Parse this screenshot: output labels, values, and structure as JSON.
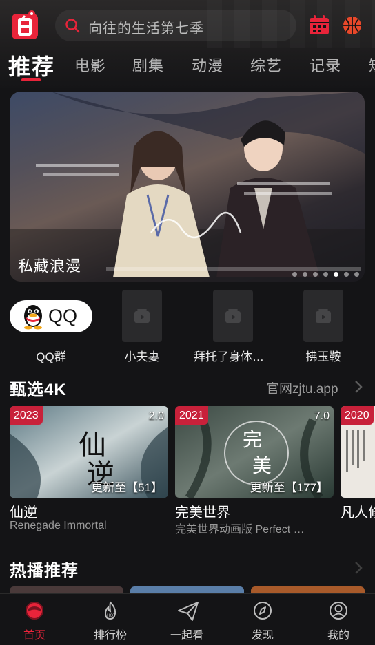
{
  "header": {
    "search_placeholder": "向往的生活第七季",
    "icons": [
      "app-logo-icon",
      "search-icon",
      "calendar-icon",
      "basketball-icon"
    ]
  },
  "tabs": [
    {
      "label": "推荐",
      "active": true
    },
    {
      "label": "电影",
      "active": false
    },
    {
      "label": "剧集",
      "active": false
    },
    {
      "label": "动漫",
      "active": false
    },
    {
      "label": "综艺",
      "active": false
    },
    {
      "label": "记录",
      "active": false
    },
    {
      "label": "短",
      "active": false
    }
  ],
  "banner": {
    "title": "私藏浪漫",
    "slide_count": 7,
    "active_slide": 4
  },
  "quick_links": [
    {
      "label": "QQ群",
      "badge_text": "QQ"
    },
    {
      "label": "小夫妻"
    },
    {
      "label": "拜托了身体…"
    },
    {
      "label": "拂玉鞍"
    }
  ],
  "section_4k": {
    "title": "甄选4K",
    "link": "官网zjtu.app",
    "cards": [
      {
        "year": "2023",
        "score": "2.0",
        "update": "更新至【51】",
        "title": "仙逆",
        "subtitle": "Renegade Immortal"
      },
      {
        "year": "2021",
        "score": "7.0",
        "update": "更新至【177】",
        "title": "完美世界",
        "subtitle": "完美世界动画版  Perfect …"
      },
      {
        "year": "2020",
        "score": "",
        "update": "",
        "title": "凡人修",
        "subtitle": ""
      }
    ]
  },
  "section_hot": {
    "title": "热播推荐"
  },
  "bottom_nav": [
    {
      "label": "首页",
      "icon": "home-icon",
      "active": true
    },
    {
      "label": "排行榜",
      "icon": "flame-icon",
      "active": false
    },
    {
      "label": "一起看",
      "icon": "paper-plane-icon",
      "active": false
    },
    {
      "label": "发现",
      "icon": "compass-icon",
      "active": false
    },
    {
      "label": "我的",
      "icon": "user-icon",
      "active": false
    }
  ],
  "colors": {
    "accent": "#e8243a",
    "background": "#141416",
    "year_badge": "#c8213a"
  }
}
